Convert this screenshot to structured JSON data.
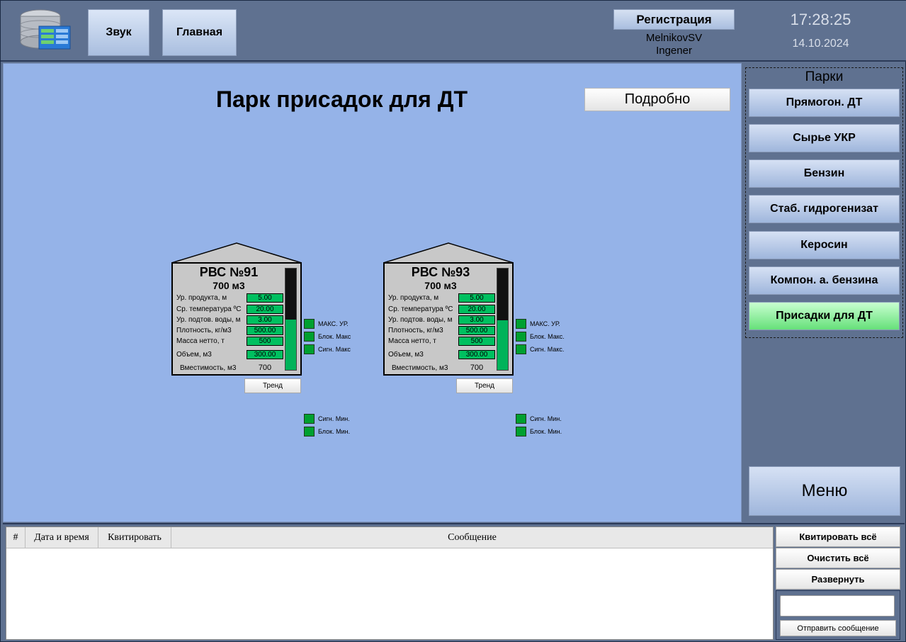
{
  "header": {
    "sound_label": "Звук",
    "home_label": "Главная",
    "registration_label": "Регистрация",
    "user_name": "MelnikovSV",
    "user_role": "Ingener",
    "time": "17:28:25",
    "date": "14.10.2024"
  },
  "main": {
    "title": "Парк присадок для ДТ",
    "details_label": "Подробно"
  },
  "tanks": [
    {
      "name": "РВС №91",
      "capacity_label": "700 м3",
      "level_fraction": 0.5,
      "params": {
        "level_label": "Ур. продукта, м",
        "level": "5.00",
        "temp_label": "Ср. температура ºС",
        "temp": "20.00",
        "water_label": "Ур. подтов. воды, м",
        "water": "3.00",
        "density_label": "Плотность, кг/м3",
        "density": "500.00",
        "mass_label": "Масса нетто, т",
        "mass": "500",
        "volume_label": "Объем, м3",
        "volume": "300.00",
        "capacity_row_label": "Вместимость, м3",
        "capacity": "700"
      },
      "alarms": {
        "max_level": "МАКС. УР.",
        "block_max": "Блок. Макс",
        "signal_max": "Сигн. Макс",
        "signal_min": "Сигн. Мин.",
        "block_min": "Блок. Мин."
      },
      "trend_label": "Тренд"
    },
    {
      "name": "РВС №93",
      "capacity_label": "700 м3",
      "level_fraction": 0.49,
      "params": {
        "level_label": "Ур. продукта, м",
        "level": "5.00",
        "temp_label": "Ср. температура ºС",
        "temp": "20.00",
        "water_label": "Ур. подтов. воды, м",
        "water": "3.00",
        "density_label": "Плотность, кг/м3",
        "density": "500.00",
        "mass_label": "Масса нетто, т",
        "mass": "500",
        "volume_label": "Объем, м3",
        "volume": "300.00",
        "capacity_row_label": "Вместимость, м3",
        "capacity": "700"
      },
      "alarms": {
        "max_level": "МАКС. УР.",
        "block_max": "Блок. Макс.",
        "signal_max": "Сигн. Макс.",
        "signal_min": "Сигн. Мин.",
        "block_min": "Блок. Мин."
      },
      "trend_label": "Тренд"
    }
  ],
  "parks": {
    "title": "Парки",
    "items": [
      {
        "label": "Прямогон. ДТ",
        "active": false
      },
      {
        "label": "Сырье УКР",
        "active": false
      },
      {
        "label": "Бензин",
        "active": false
      },
      {
        "label": "Стаб. гидрогенизат",
        "active": false
      },
      {
        "label": "Керосин",
        "active": false
      },
      {
        "label": "Компон. а. бензина",
        "active": false
      },
      {
        "label": "Присадки для ДТ",
        "active": true
      }
    ],
    "menu_label": "Меню"
  },
  "messages": {
    "columns": [
      "#",
      "Дата и время",
      "Квитировать",
      "Сообщение"
    ],
    "ack_all_label": "Квитировать всё",
    "clear_all_label": "Очистить всё",
    "expand_label": "Развернуть",
    "send_label": "Отправить сообщение",
    "input_value": ""
  },
  "colors": {
    "panel": "#5f7190",
    "workspace": "#95b3e8",
    "indicator_green": "#00a030",
    "active_park": "#66e07a"
  }
}
